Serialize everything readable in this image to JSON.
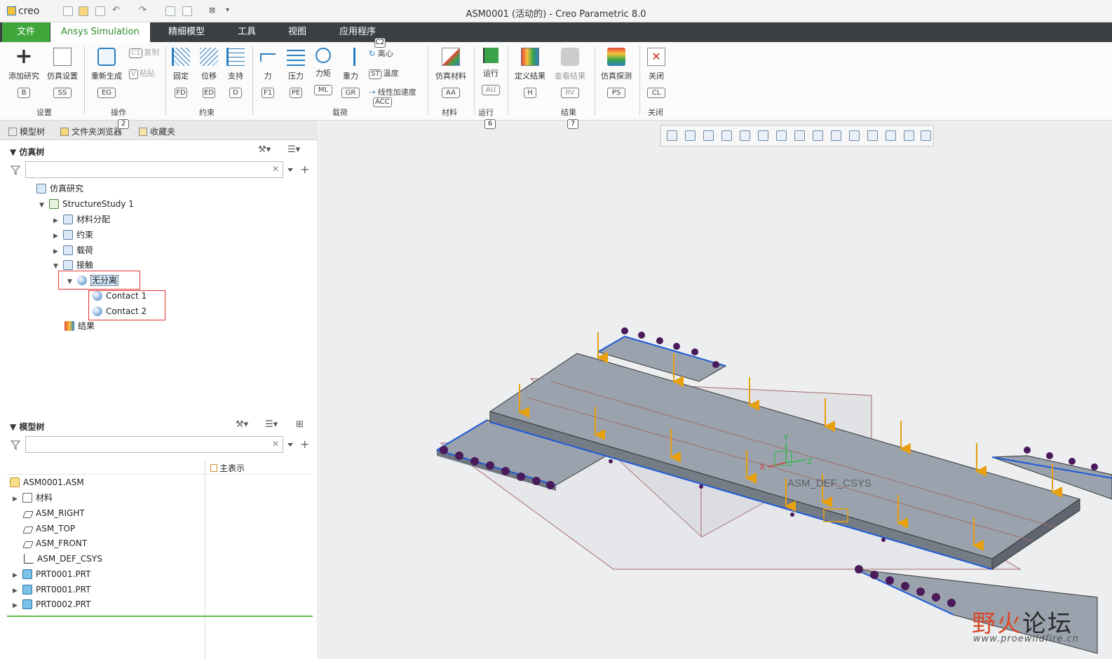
{
  "app": {
    "logo": "creo",
    "title": "ASM0001 (活动的) - Creo Parametric 8.0"
  },
  "tabs": [
    {
      "label": "文件"
    },
    {
      "label": "Ansys Simulation"
    },
    {
      "label": "精细模型"
    },
    {
      "label": "工具"
    },
    {
      "label": "视图"
    },
    {
      "label": "应用程序"
    }
  ],
  "ribbon": {
    "add_study": {
      "label": "添加研究",
      "key": "B"
    },
    "sim_setup": {
      "label": "仿真设置",
      "key": "SS"
    },
    "group_setup": "设置",
    "copy": {
      "label": "复制",
      "key": "C1"
    },
    "paste": {
      "label": "粘贴",
      "key": "V"
    },
    "regen": {
      "label": "重新生成",
      "key": "EG"
    },
    "group_ops": "操作",
    "fixed": {
      "label": "固定",
      "key": "FD"
    },
    "displacement": {
      "label": "位移",
      "key": "ED"
    },
    "support": {
      "label": "支持",
      "key": "D"
    },
    "group_constraint": "约束",
    "force": {
      "label": "力",
      "key": "F1"
    },
    "pressure": {
      "label": "压力",
      "key": "PE"
    },
    "moment": {
      "label": "力矩",
      "key": "ML"
    },
    "gravity": {
      "label": "重力",
      "key": "GR"
    },
    "centrifugal": {
      "label": "离心",
      "key": "C2"
    },
    "temperature": {
      "label": "温度",
      "key": "ST"
    },
    "linear_accel": {
      "label": "线性加速度",
      "key": "ACC"
    },
    "group_loads": "载荷",
    "material": {
      "label": "仿真材料",
      "key": "AA"
    },
    "group_material": "材料",
    "run": {
      "label": "运行",
      "key": "AU"
    },
    "group_run": "运行",
    "define_results": {
      "label": "定义结果",
      "key": "H"
    },
    "view_results": {
      "label": "查看结果",
      "key": "RV"
    },
    "group_results": "结果",
    "probe": {
      "label": "仿真探测",
      "key": "PS"
    },
    "close": {
      "label": "关闭",
      "key": "CL"
    },
    "group_close": "关闭",
    "badges": [
      "2",
      "6",
      "7"
    ]
  },
  "pane_tabs": [
    {
      "label": "模型树"
    },
    {
      "label": "文件夹浏览器"
    },
    {
      "label": "收藏夹"
    }
  ],
  "sim_tree": {
    "header": "仿真树",
    "filter_value": "",
    "items": [
      {
        "label": "仿真研究"
      },
      {
        "label": "StructureStudy 1"
      },
      {
        "label": "材料分配"
      },
      {
        "label": "约束"
      },
      {
        "label": "载荷"
      },
      {
        "label": "接触"
      },
      {
        "label": "无分离"
      },
      {
        "label": "Contact 1"
      },
      {
        "label": "Contact 2"
      },
      {
        "label": "结果"
      }
    ]
  },
  "model_tree": {
    "header": "模型树",
    "filter_value": "",
    "column": "主表示",
    "items": [
      {
        "label": "ASM0001.ASM"
      },
      {
        "label": "材料"
      },
      {
        "label": "ASM_RIGHT"
      },
      {
        "label": "ASM_TOP"
      },
      {
        "label": "ASM_FRONT"
      },
      {
        "label": "ASM_DEF_CSYS"
      },
      {
        "label": "PRT0001.PRT"
      },
      {
        "label": "PRT0001.PRT"
      },
      {
        "label": "PRT0002.PRT"
      }
    ]
  },
  "viewport": {
    "csys_label": "ASM_DEF_CSYS",
    "axis_labels": {
      "x": "X",
      "y": "Y",
      "z": "Z"
    }
  },
  "watermark": {
    "title_a": "野火",
    "title_b": "论坛",
    "url": "www.proewildfire.cn"
  },
  "colors": {
    "accent": "#3ea63a",
    "load_arrow": "#e8a00f",
    "constraint": "#4a1a5a",
    "highlight_box": "#e0302a",
    "part_face": "#9aa3ad"
  }
}
